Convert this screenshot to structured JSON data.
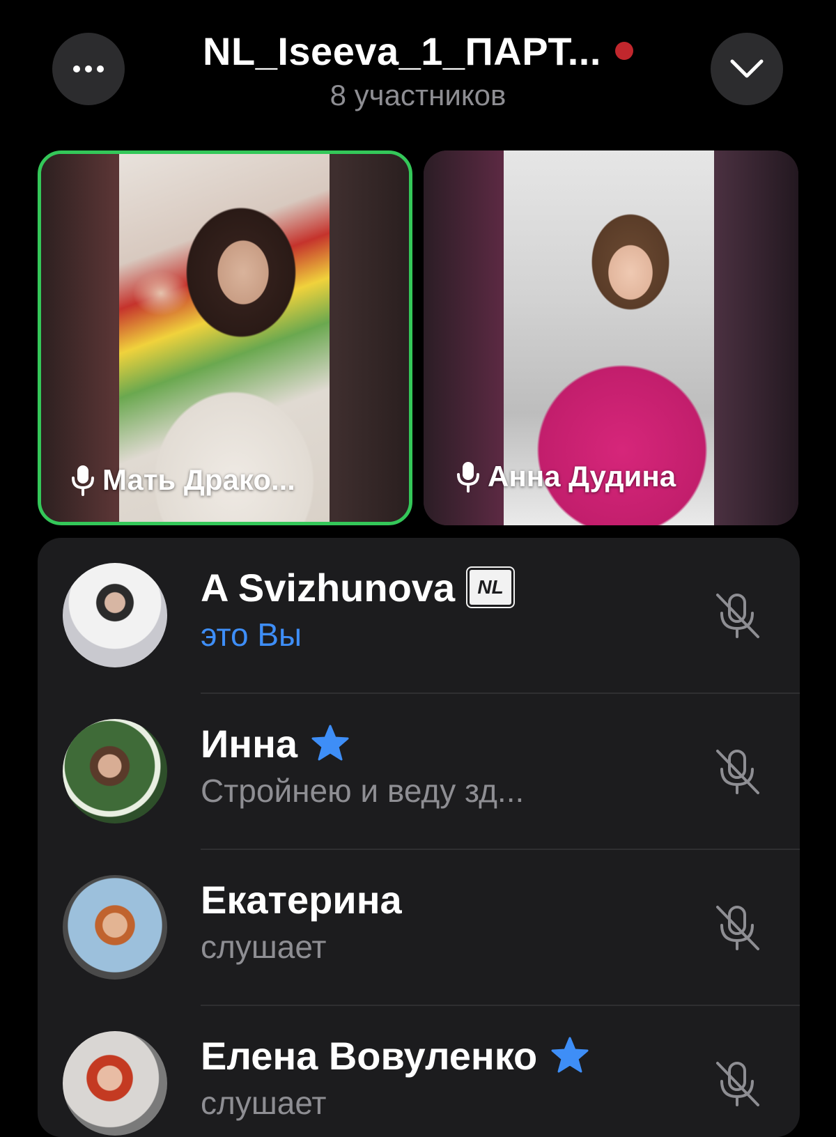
{
  "header": {
    "title": "NL_Iseeva_1_ПАРТ...",
    "subtitle": "8 участников",
    "recording_color": "#c1272d"
  },
  "videos": [
    {
      "name": "Мать Драко...",
      "speaking": true,
      "border_color": "#34c759"
    },
    {
      "name": "Анна Дудина",
      "speaking": false
    }
  ],
  "participants": [
    {
      "name": "A Svizhunova",
      "badge": "NL",
      "status": "это Вы",
      "is_you": true,
      "muted": true
    },
    {
      "name": "Инна",
      "badge_icon": "star-icon",
      "status": "Стройнею и веду зд...",
      "muted": true
    },
    {
      "name": "Екатерина",
      "status": "слушает",
      "muted": true
    },
    {
      "name": "Елена Вовуленко",
      "badge_icon": "star-icon",
      "status": "слушает",
      "muted": true
    }
  ],
  "colors": {
    "accent_blue": "#3e8ef7",
    "star_blue": "#3e8ef7",
    "secondary_text": "#8e8e93",
    "panel": "#1c1c1e"
  }
}
